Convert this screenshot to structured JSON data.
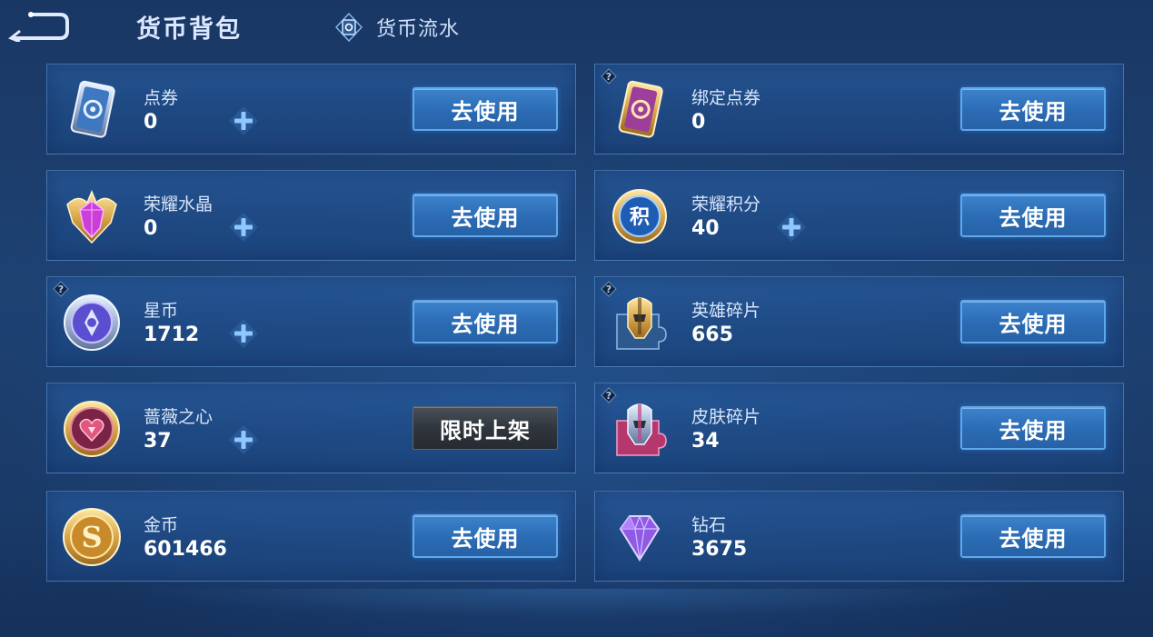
{
  "header": {
    "title": "货币背包",
    "flow_label": "货币流水"
  },
  "currencies": [
    {
      "name": "点券",
      "value": "0",
      "icon": "voucher-card-icon",
      "button": "去使用",
      "has_plus": true,
      "has_help": false
    },
    {
      "name": "绑定点券",
      "value": "0",
      "icon": "bound-voucher-card-icon",
      "button": "去使用",
      "has_plus": false,
      "has_help": true
    },
    {
      "name": "荣耀水晶",
      "value": "0",
      "icon": "glory-crystal-icon",
      "button": "去使用",
      "has_plus": true,
      "has_help": false
    },
    {
      "name": "荣耀积分",
      "value": "40",
      "icon": "glory-points-icon",
      "button": "去使用",
      "has_plus": true,
      "has_help": false
    },
    {
      "name": "星币",
      "value": "1712",
      "icon": "star-coin-icon",
      "button": "去使用",
      "has_plus": true,
      "has_help": true
    },
    {
      "name": "英雄碎片",
      "value": "665",
      "icon": "hero-fragment-icon",
      "button": "去使用",
      "has_plus": false,
      "has_help": true
    },
    {
      "name": "蔷薇之心",
      "value": "37",
      "icon": "rose-heart-icon",
      "button": "限时上架",
      "has_plus": true,
      "has_help": false
    },
    {
      "name": "皮肤碎片",
      "value": "34",
      "icon": "skin-fragment-icon",
      "button": "去使用",
      "has_plus": false,
      "has_help": true
    },
    {
      "name": "金币",
      "value": "601466",
      "icon": "gold-coin-icon",
      "button": "去使用",
      "has_plus": false,
      "has_help": false
    },
    {
      "name": "钻石",
      "value": "3675",
      "icon": "diamond-icon",
      "button": "去使用",
      "has_plus": false,
      "has_help": false
    }
  ],
  "icon_glyphs": {
    "glory_points": "积",
    "gold_coin": "S"
  },
  "colors": {
    "accent_button": "#2b6bb3",
    "button_border": "#5fa8ec",
    "limited_button": "#30363d",
    "plus_icon": "#8fc7ff"
  }
}
